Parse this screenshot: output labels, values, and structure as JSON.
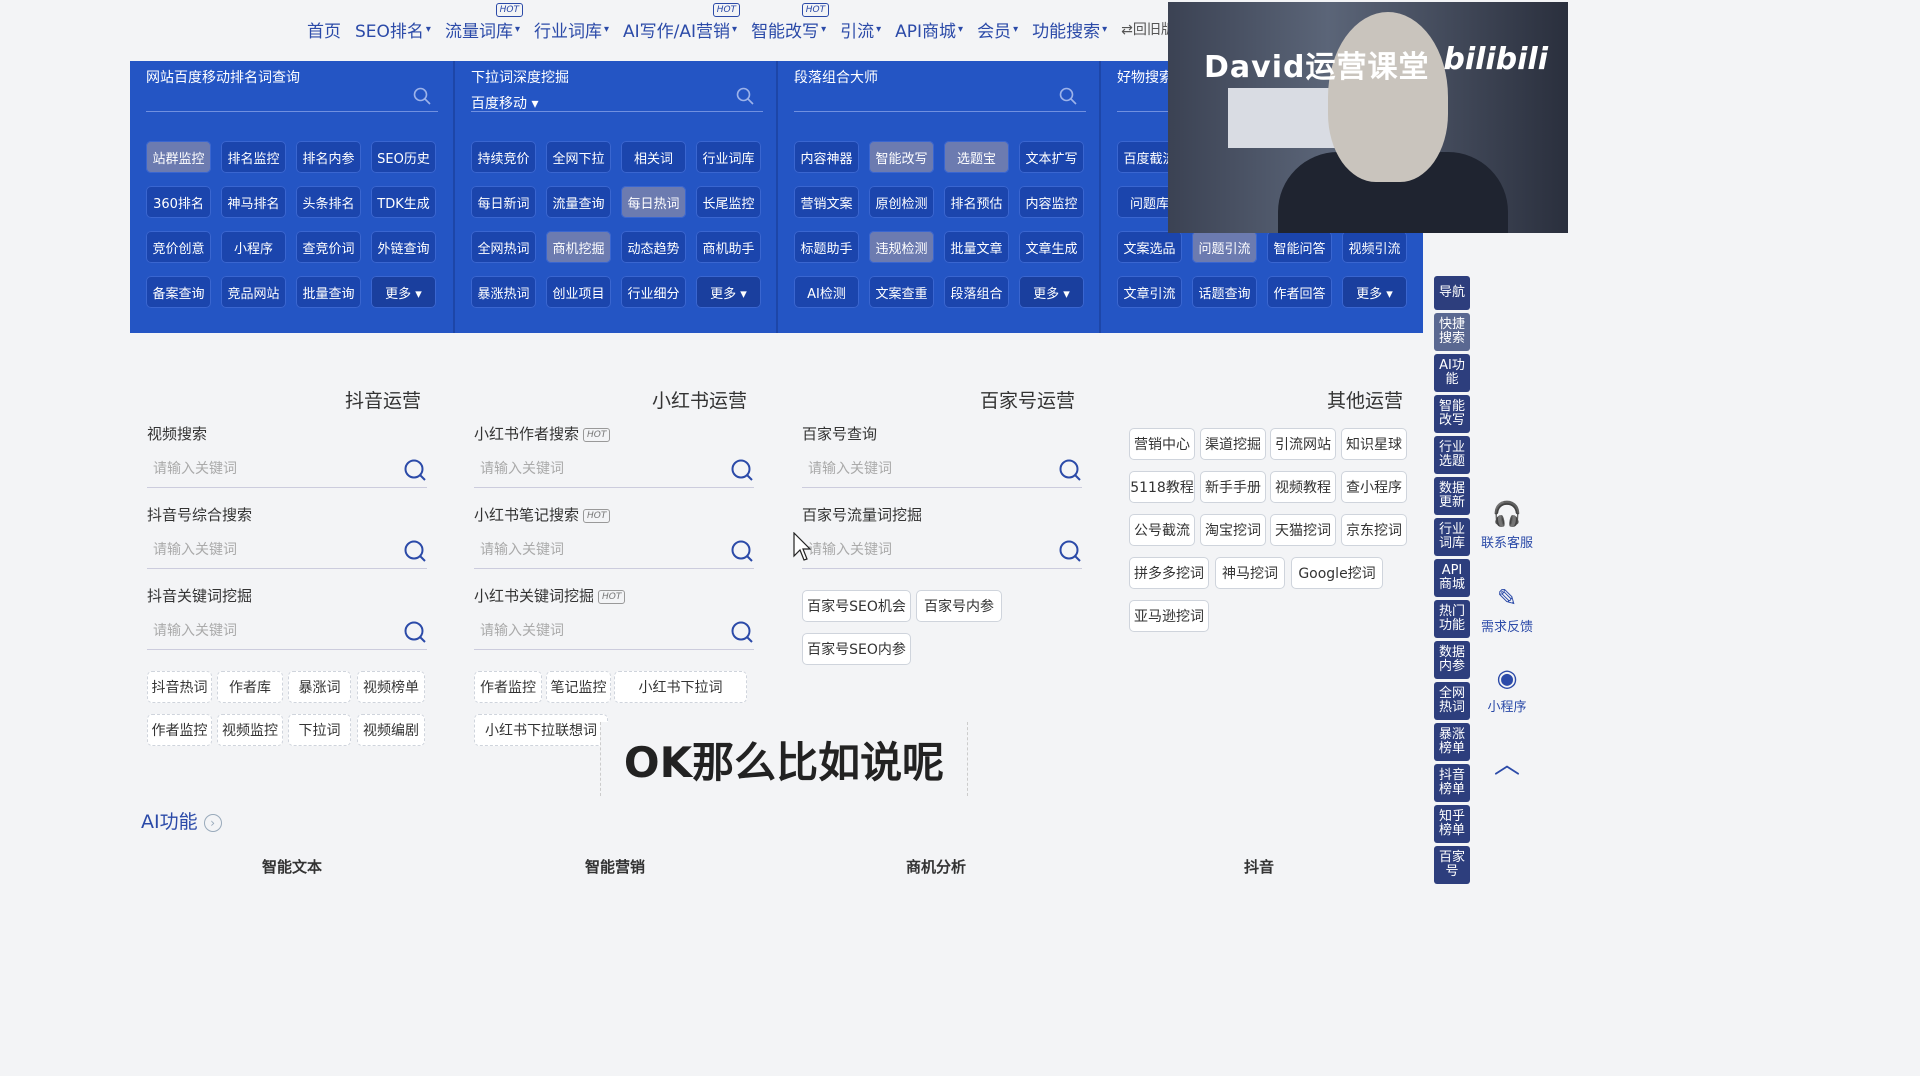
{
  "nav": {
    "items": [
      {
        "label": "首页",
        "caret": "",
        "hot": ""
      },
      {
        "label": "SEO排名",
        "caret": "▾",
        "hot": ""
      },
      {
        "label": "流量词库",
        "caret": "▾",
        "hot": "HOT"
      },
      {
        "label": "行业词库",
        "caret": "▾",
        "hot": ""
      },
      {
        "label": "AI写作/AI营销",
        "caret": "▾",
        "hot": "HOT"
      },
      {
        "label": "智能改写",
        "caret": "▾",
        "hot": "HOT"
      },
      {
        "label": "引流",
        "caret": "▾",
        "hot": ""
      },
      {
        "label": "API商城",
        "caret": "▾",
        "hot": ""
      },
      {
        "label": "会员",
        "caret": "▾",
        "hot": ""
      },
      {
        "label": "功能搜索",
        "caret": "▾",
        "hot": ""
      }
    ],
    "back_old": "⇄回旧版"
  },
  "panel": {
    "columns": [
      {
        "title": "网站百度移动排名词查询",
        "sub": "",
        "buttons": [
          "站群监控",
          "排名监控",
          "排名内参",
          "SEO历史",
          "360排名",
          "神马排名",
          "头条排名",
          "TDK生成",
          "竞价创意",
          "小程序",
          "查竞价词",
          "外链查询",
          "备案查询",
          "竞品网站",
          "批量查询",
          "更多 ▾"
        ]
      },
      {
        "title": "下拉词深度挖掘",
        "sub": "百度移动 ▾",
        "buttons": [
          "持续竞价",
          "全网下拉",
          "相关词",
          "行业词库",
          "每日新词",
          "流量查询",
          "每日热词",
          "长尾监控",
          "全网热词",
          "商机挖掘",
          "动态趋势",
          "商机助手",
          "暴涨热词",
          "创业项目",
          "行业细分",
          "更多 ▾"
        ]
      },
      {
        "title": "段落组合大师",
        "sub": "",
        "buttons": [
          "内容神器",
          "智能改写",
          "选题宝",
          "文本扩写",
          "营销文案",
          "原创检测",
          "排名预估",
          "内容监控",
          "标题助手",
          "违规检测",
          "批量文章",
          "文章生成",
          "AI检测",
          "文案查重",
          "段落组合",
          "更多 ▾"
        ]
      },
      {
        "title": "好物搜索",
        "sub": "",
        "buttons": [
          "百度截流",
          "",
          "",
          "",
          "问题库",
          "",
          "",
          "",
          "文案选品",
          "问题引流",
          "智能问答",
          "视频引流",
          "文章引流",
          "话题查询",
          "作者回答",
          "更多 ▾"
        ]
      }
    ]
  },
  "webcam": {
    "brand": "David运营课堂",
    "logo": "bilibili"
  },
  "sections": {
    "douyin": {
      "title": "抖音运营",
      "fields": [
        {
          "label": "视频搜索",
          "hot": "",
          "placeholder": "请输入关键词"
        },
        {
          "label": "抖音号综合搜索",
          "hot": "",
          "placeholder": "请输入关键词"
        },
        {
          "label": "抖音关键词挖掘",
          "hot": "",
          "placeholder": "请输入关键词"
        }
      ],
      "chips": [
        "抖音热词",
        "作者库",
        "暴涨词",
        "视频榜单",
        "作者监控",
        "视频监控",
        "下拉词",
        "视频编剧"
      ]
    },
    "xhs": {
      "title": "小红书运营",
      "fields": [
        {
          "label": "小红书作者搜索",
          "hot": "HOT",
          "placeholder": "请输入关键词"
        },
        {
          "label": "小红书笔记搜索",
          "hot": "HOT",
          "placeholder": "请输入关键词"
        },
        {
          "label": "小红书关键词挖掘",
          "hot": "HOT",
          "placeholder": "请输入关键词"
        }
      ],
      "chips": [
        "作者监控",
        "笔记监控",
        "小红书下拉词",
        "小红书下拉联想词"
      ]
    },
    "baijia": {
      "title": "百家号运营",
      "fields": [
        {
          "label": "百家号查询",
          "hot": "",
          "placeholder": "请输入关键词"
        },
        {
          "label": "百家号流量词挖掘",
          "hot": "",
          "placeholder": "请输入关键词"
        }
      ],
      "chips": [
        "百家号SEO机会",
        "百家号内参",
        "百家号SEO内参"
      ]
    },
    "other": {
      "title": "其他运营",
      "chips": [
        "营销中心",
        "渠道挖掘",
        "引流网站",
        "知识星球",
        "5118教程",
        "新手手册",
        "视频教程",
        "查小程序",
        "公号截流",
        "淘宝挖词",
        "天猫挖词",
        "京东挖词",
        "拼多多挖词",
        "神马挖词",
        "Google挖词",
        "亚马逊挖词"
      ]
    }
  },
  "sidebar": {
    "items": [
      "导航",
      "快捷搜索",
      "AI功能",
      "智能改写",
      "行业选题",
      "数据更新",
      "行业词库",
      "API商城",
      "热门功能",
      "数据内参",
      "全网热词",
      "暴涨榜单",
      "抖音榜单",
      "知乎榜单",
      "百家号"
    ]
  },
  "float": {
    "service": "联系客服",
    "feedback": "需求反馈",
    "miniprogram": "小程序"
  },
  "subtitle": "OK那么比如说呢",
  "ai": {
    "title": "AI功能",
    "tabs": [
      "智能文本",
      "智能营销",
      "商机分析",
      "抖音"
    ]
  }
}
